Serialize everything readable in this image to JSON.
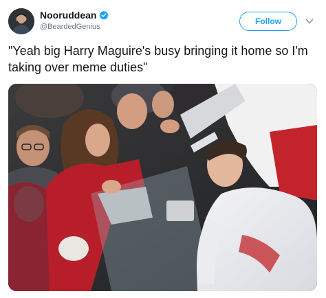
{
  "tweet": {
    "author": {
      "display_name": "Nooruddean",
      "handle": "@BeardedGenius",
      "verified": true,
      "avatar_icon": "avatar-photo"
    },
    "follow_label": "Follow",
    "more_icon": "chevron-down-icon",
    "text": "\"Yeah big Harry Maguire's busy bringing it home so I'm taking over meme duties\"",
    "media": {
      "type": "photo",
      "subject": "football player in white kit leaning over barrier toward crowd"
    }
  },
  "colors": {
    "accent": "#1da1f2",
    "handle_gray": "#657786",
    "text": "#14171a"
  }
}
